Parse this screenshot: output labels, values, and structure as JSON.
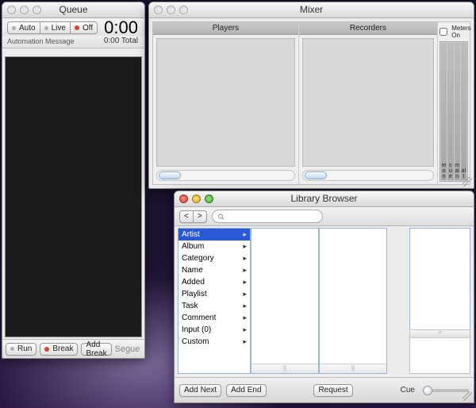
{
  "queue": {
    "title": "Queue",
    "modes": {
      "auto": "Auto",
      "live": "Live",
      "off": "Off"
    },
    "clock": "0:00",
    "clock_total": "0:00 Total",
    "automation_msg": "Automation Message",
    "footer": {
      "run": "Run",
      "break": "Break",
      "add_break": "Add Break",
      "segue": "Segue"
    }
  },
  "mixer": {
    "title": "Mixer",
    "players_label": "Players",
    "recorders_label": "Recorders",
    "meters_on": "Meters On",
    "meters": [
      "mon",
      "cue",
      "main",
      "alt"
    ]
  },
  "library": {
    "title": "Library Browser",
    "nav": {
      "back": "<",
      "fwd": ">"
    },
    "search_placeholder": "",
    "categories": [
      {
        "label": "Artist",
        "selected": true
      },
      {
        "label": "Album"
      },
      {
        "label": "Category"
      },
      {
        "label": "Name"
      },
      {
        "label": "Added"
      },
      {
        "label": "Playlist"
      },
      {
        "label": "Task"
      },
      {
        "label": "Comment"
      },
      {
        "label": "Input (0)"
      },
      {
        "label": "Custom"
      }
    ],
    "footer": {
      "add_next": "Add Next",
      "add_end": "Add End",
      "request": "Request",
      "cue": "Cue"
    }
  }
}
